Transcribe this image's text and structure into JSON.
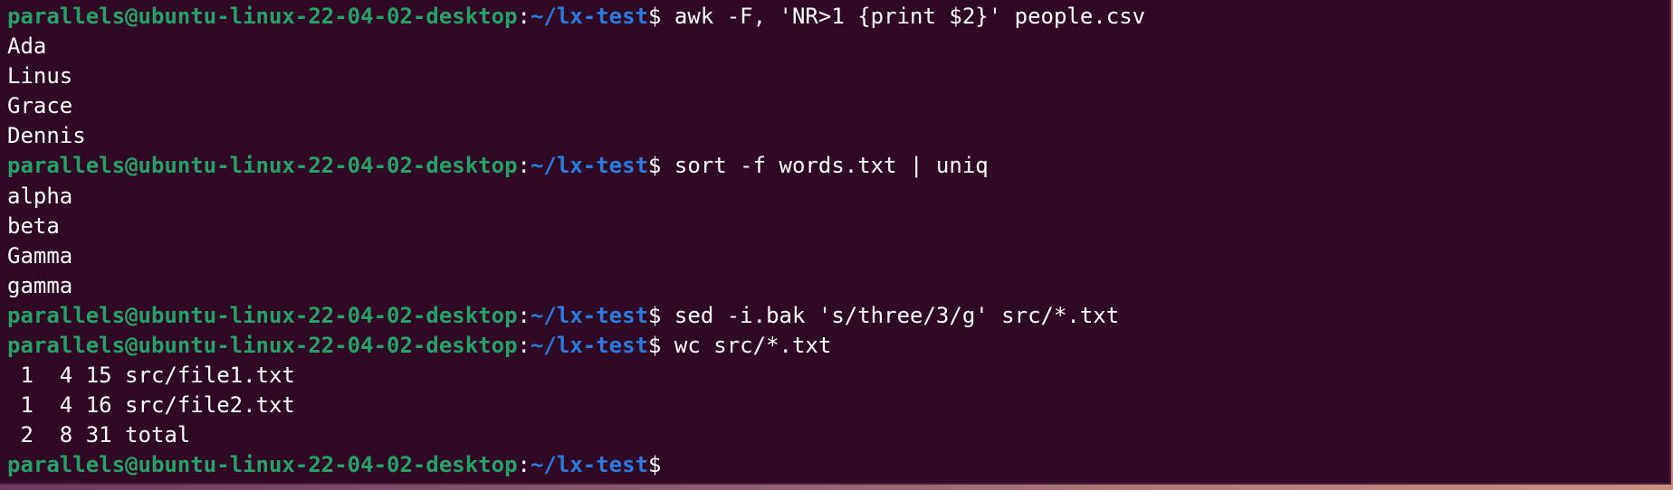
{
  "terminal": {
    "prompt": {
      "user_host": "parallels@ubuntu-linux-22-04-02-desktop",
      "separator": ":",
      "path": "~/lx-test",
      "symbol": "$"
    },
    "lines": [
      {
        "type": "command",
        "text": " awk -F, 'NR>1 {print $2}' people.csv"
      },
      {
        "type": "output",
        "text": "Ada"
      },
      {
        "type": "output",
        "text": "Linus"
      },
      {
        "type": "output",
        "text": "Grace"
      },
      {
        "type": "output",
        "text": "Dennis"
      },
      {
        "type": "command",
        "text": " sort -f words.txt | uniq"
      },
      {
        "type": "output",
        "text": "alpha"
      },
      {
        "type": "output",
        "text": "beta"
      },
      {
        "type": "output",
        "text": "Gamma"
      },
      {
        "type": "output",
        "text": "gamma"
      },
      {
        "type": "command",
        "text": " sed -i.bak 's/three/3/g' src/*.txt"
      },
      {
        "type": "command",
        "text": " wc src/*.txt"
      },
      {
        "type": "output",
        "text": " 1  4 15 src/file1.txt"
      },
      {
        "type": "output",
        "text": " 1  4 16 src/file2.txt"
      },
      {
        "type": "output",
        "text": " 2  8 31 total"
      },
      {
        "type": "command",
        "text": ""
      }
    ],
    "colors": {
      "background": "#300a24",
      "user_host": "#26a269",
      "path": "#2a7bde",
      "text": "#ffffff"
    }
  }
}
